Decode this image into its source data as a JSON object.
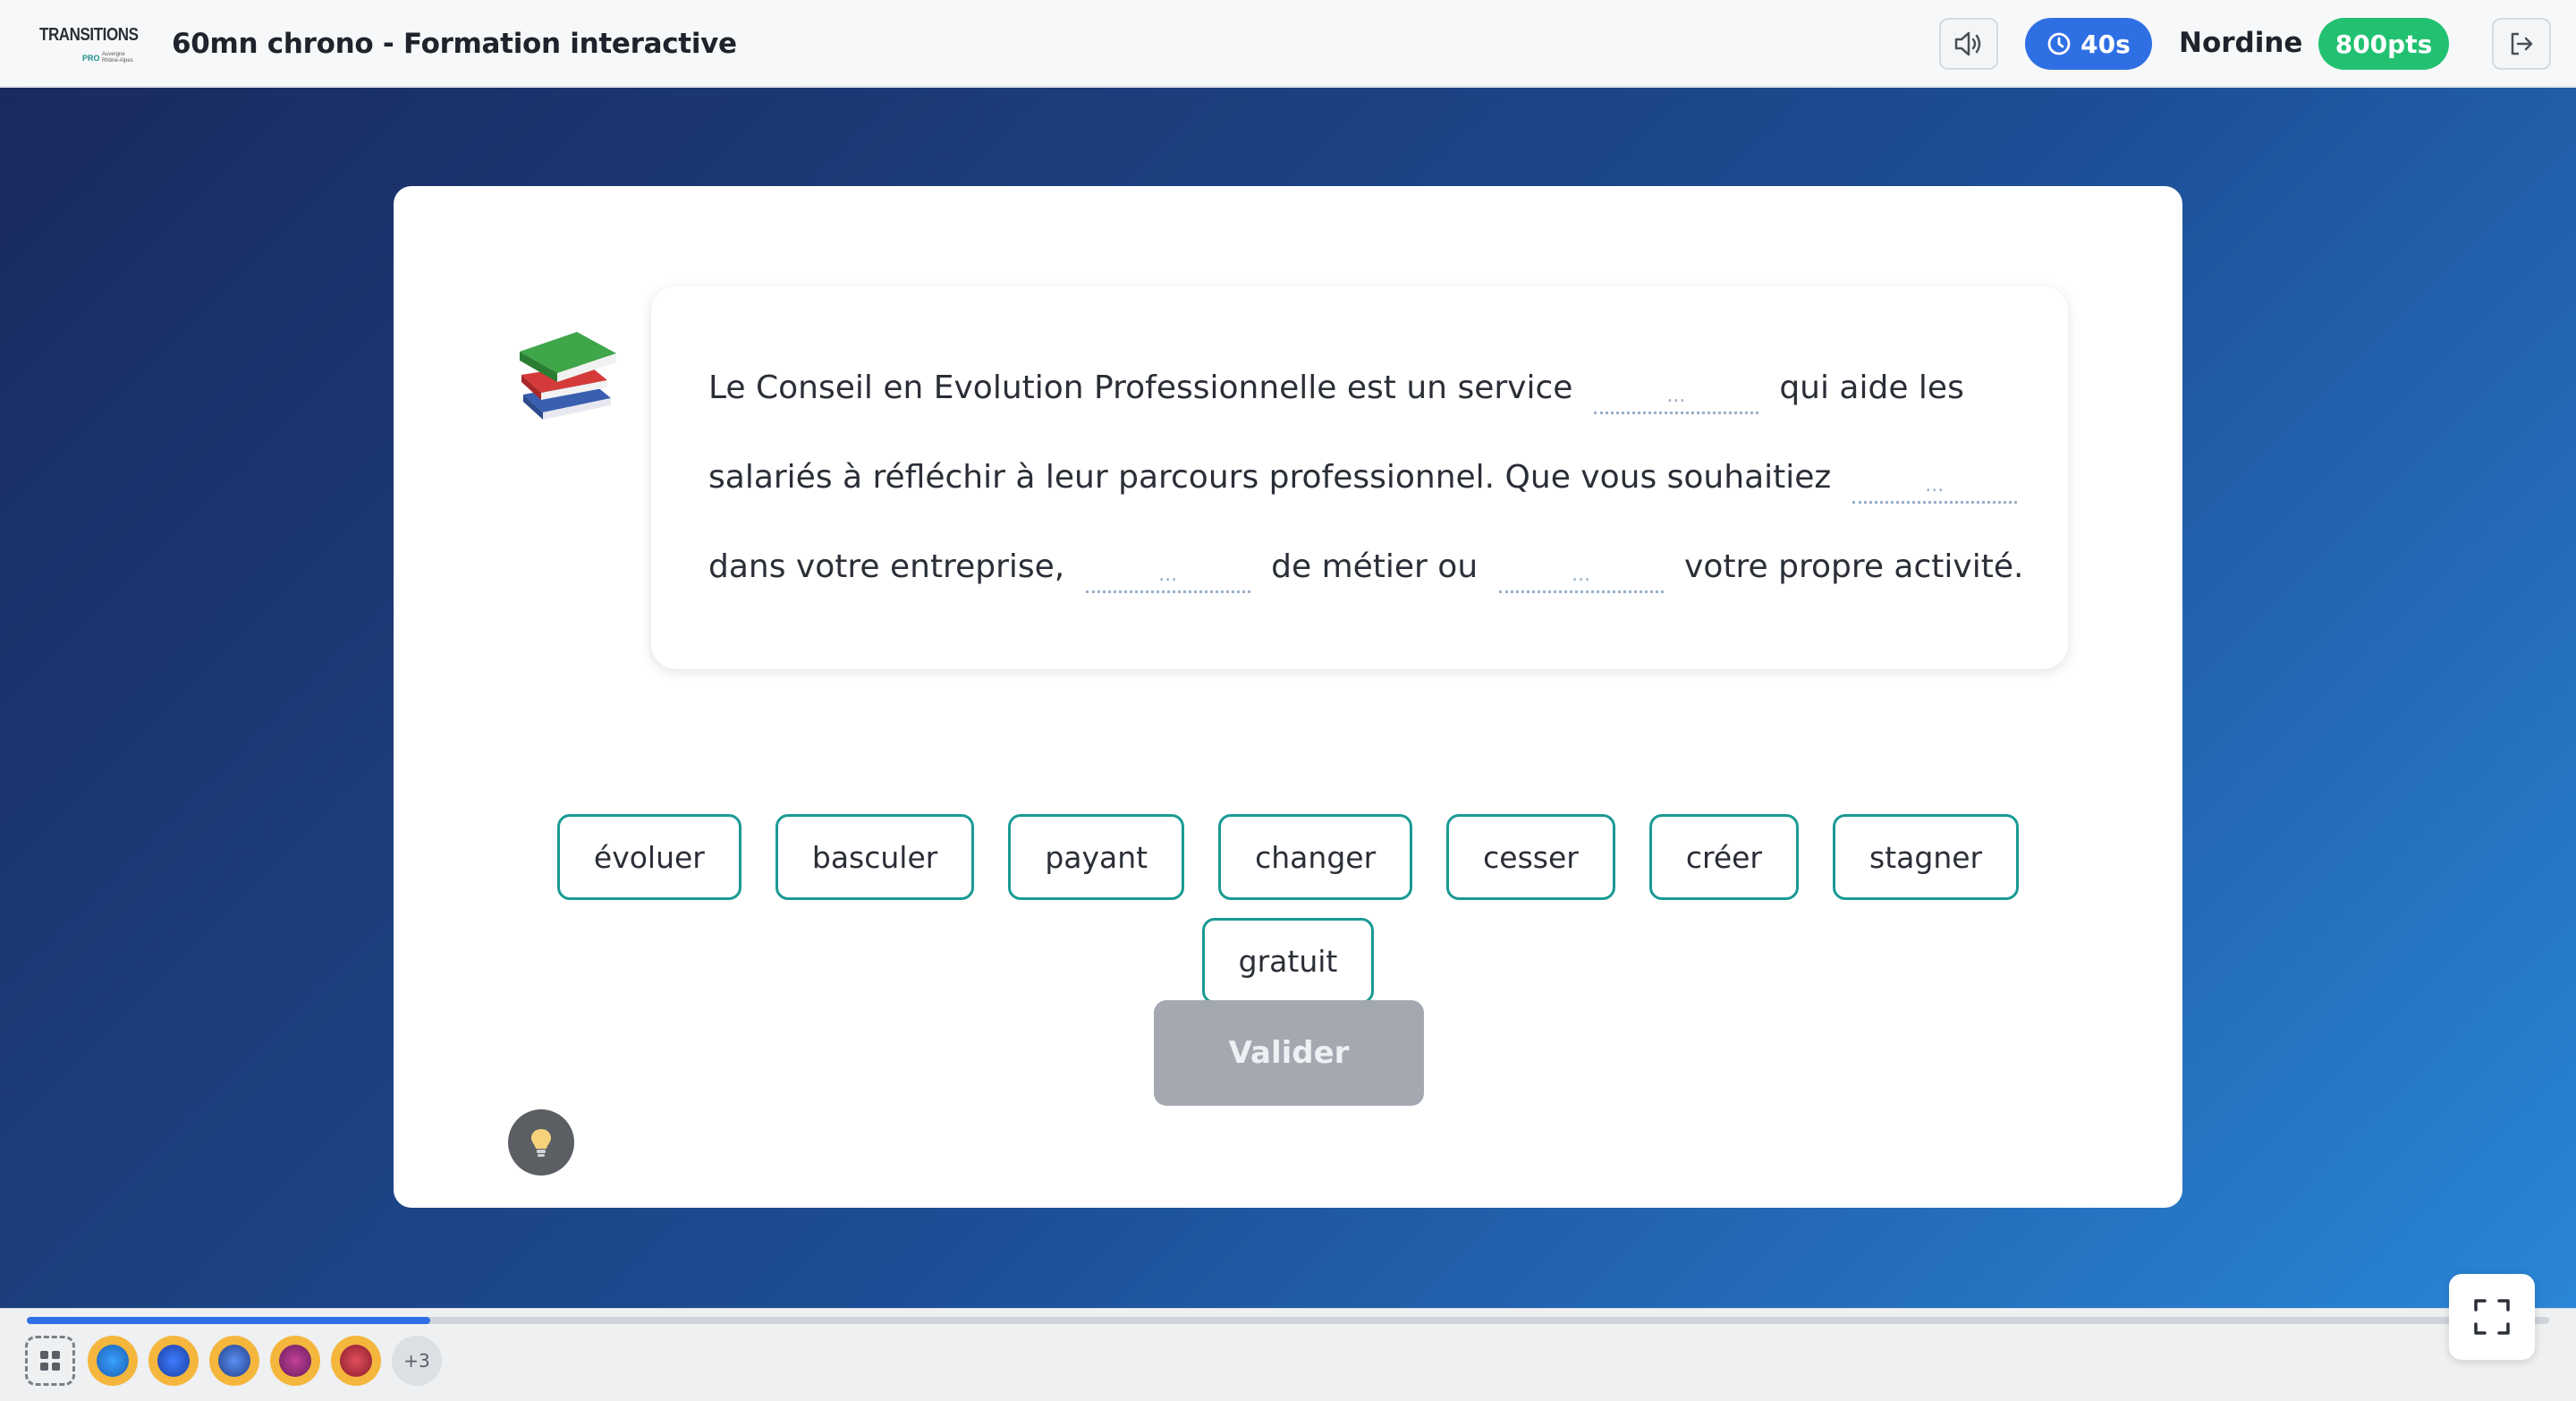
{
  "header": {
    "logo_text": "TRANSITIONS",
    "logo_sub": "PRO",
    "logo_region": "Auvergne Rhône-Alpes",
    "title": "60mn chrono - Formation interactive",
    "timer": "40s",
    "user_name": "Nordine",
    "points": "800pts"
  },
  "exercise": {
    "sentence_parts": [
      "Le Conseil en Evolution Professionnelle est un service",
      "qui aide les salariés à réfléchir à leur parcours professionnel. Que vous souhaitiez",
      "dans votre entreprise,",
      "de métier ou",
      "votre propre activité."
    ],
    "blank_placeholder": "...",
    "words": [
      "évoluer",
      "basculer",
      "payant",
      "changer",
      "cesser",
      "créer",
      "stagner",
      "gratuit"
    ],
    "validate_label": "Valider"
  },
  "footer": {
    "progress_fraction": 0.16,
    "more_count": "+3"
  },
  "colors": {
    "accent_blue": "#2f6fe4",
    "points_green": "#22c172",
    "chip_border": "#1a9a95"
  }
}
